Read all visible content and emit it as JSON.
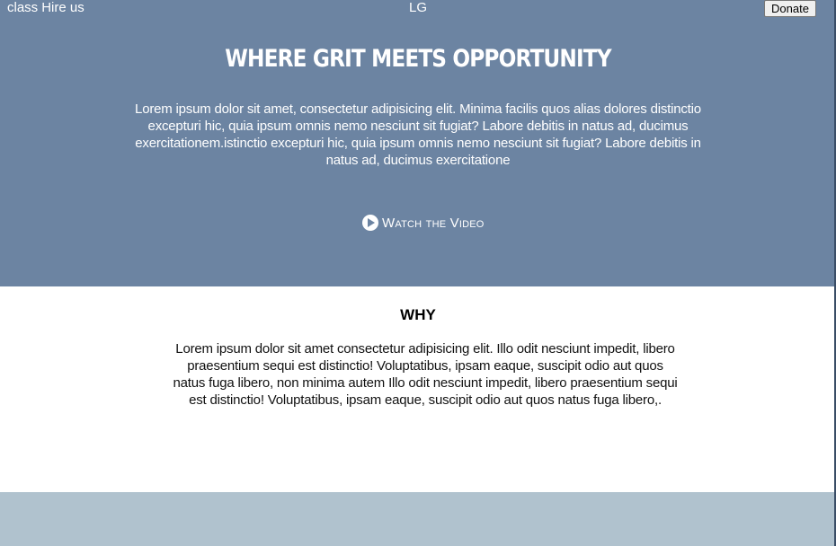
{
  "nav": {
    "items": [
      "class",
      "Hire us"
    ],
    "logo": "LG",
    "donate_label": "Donate"
  },
  "hero": {
    "title": "WHERE GRIT MEETS OPPORTUNITY",
    "text": "Lorem ipsum dolor sit amet, consectetur adipisicing elit. Minima facilis quos alias dolores distinctio excepturi hic, quia ipsum omnis nemo nesciunt sit fugiat? Labore debitis in natus ad, ducimus exercitationem.istinctio excepturi hic, quia ipsum omnis nemo nesciunt sit fugiat? Labore debitis in natus ad, ducimus exercitatione",
    "watch_label": "Watch the Video",
    "watch_icon": "play-circle-icon"
  },
  "why": {
    "title": "WHY",
    "text": "Lorem ipsum dolor sit amet consectetur adipisicing elit. Illo odit nesciunt impedit, libero praesentium sequi est distinctio! Voluptatibus, ipsam eaque, suscipit odio aut quos natus fuga libero, non minima autem Illo odit nesciunt impedit, libero praesentium sequi est distinctio! Voluptatibus, ipsam eaque, suscipit odio aut quos natus fuga libero,."
  },
  "colors": {
    "hero_bg": "#6c84a2",
    "footer_bg": "#b0c2ce",
    "body_bg": "#ffffff"
  }
}
